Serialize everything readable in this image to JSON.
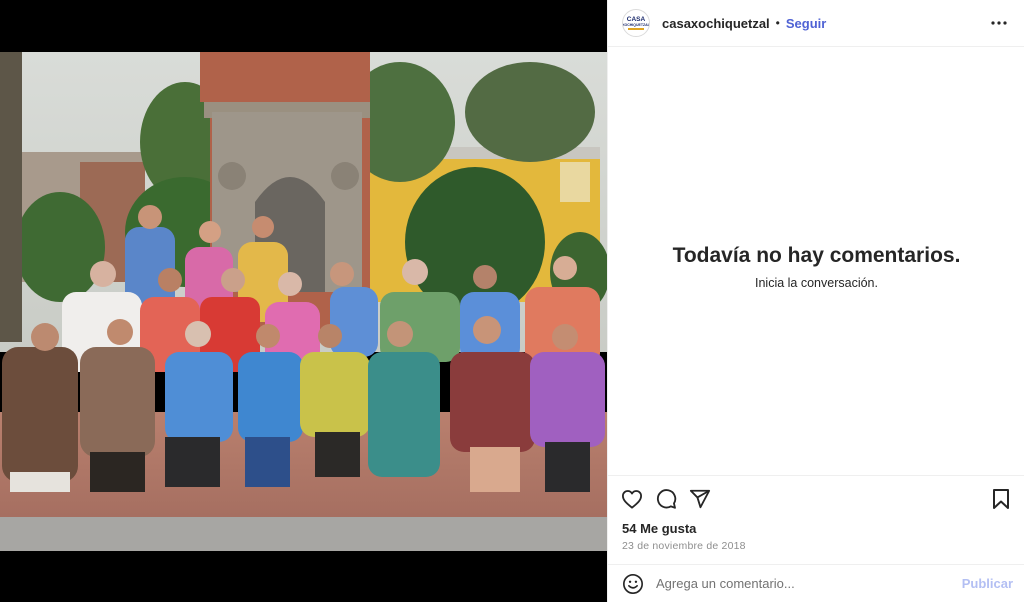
{
  "post": {
    "username": "casaxochiquetzal",
    "separator": "•",
    "follow_label": "Seguir",
    "avatar_text_line1": "CASA",
    "avatar_text_line2": "XOCHIQUETZAL",
    "more_icon": "more-horizontal-icon"
  },
  "comments": {
    "empty_title": "Todavía no hay comentarios.",
    "empty_subtitle": "Inicia la conversación."
  },
  "actions": {
    "like_icon": "heart-icon",
    "comment_icon": "comment-icon",
    "share_icon": "share-icon",
    "save_icon": "bookmark-icon"
  },
  "stats": {
    "likes": "54 Me gusta",
    "date": "23 de noviembre de 2018"
  },
  "composer": {
    "placeholder": "Agrega un comentario...",
    "publish_label": "Publicar"
  },
  "colors": {
    "follow": "#4f62d4",
    "publish_disabled": "#b3bff3",
    "border": "#efefef"
  }
}
